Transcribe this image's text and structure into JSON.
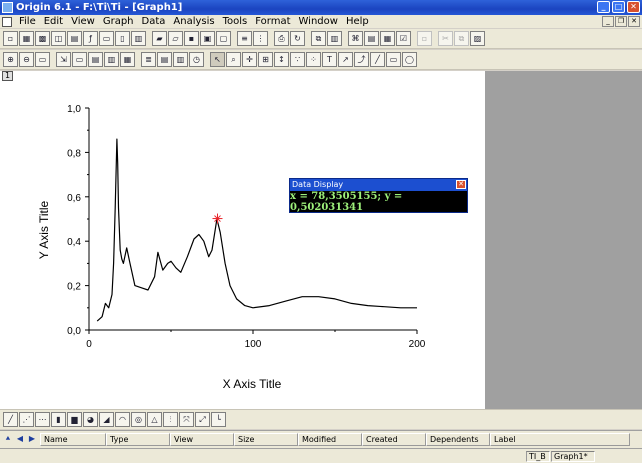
{
  "window": {
    "title": "Origin 6.1 - F:\\Ti\\Ti - [Graph1]"
  },
  "menu": [
    "File",
    "Edit",
    "View",
    "Graph",
    "Data",
    "Analysis",
    "Tools",
    "Format",
    "Window",
    "Help"
  ],
  "layer": {
    "number": "1"
  },
  "data_display": {
    "title": "Data Display",
    "readout": "x = 78,3505155; y = 0,502031341"
  },
  "explorer": {
    "columns": [
      "Name",
      "Type",
      "View",
      "Size",
      "Modified",
      "Created",
      "Dependents",
      "Label"
    ]
  },
  "status": {
    "left": "TI_B",
    "right": "Graph1*"
  },
  "chart_data": {
    "type": "line",
    "xlabel": "X Axis Title",
    "ylabel": "Y Axis Title",
    "xlim": [
      0,
      200
    ],
    "ylim": [
      0,
      1.0
    ],
    "x_ticks": [
      "0",
      "100",
      "200"
    ],
    "y_ticks": [
      "0,0",
      "0,2",
      "0,4",
      "0,6",
      "0,8",
      "1,0"
    ],
    "grid": false,
    "series": [
      {
        "color": "#000000",
        "x": [
          5,
          8,
          10,
          12,
          14,
          15,
          16,
          17,
          17.5,
          18,
          19,
          20,
          21,
          23,
          25,
          28,
          32,
          36,
          40,
          42,
          45,
          48,
          50,
          53,
          56,
          60,
          64,
          67,
          70,
          73,
          75,
          78,
          80,
          83,
          86,
          90,
          95,
          100,
          110,
          120,
          130,
          140,
          150,
          160,
          170,
          180,
          190,
          200
        ],
        "y": [
          0.04,
          0.06,
          0.12,
          0.1,
          0.16,
          0.3,
          0.55,
          0.86,
          0.75,
          0.55,
          0.36,
          0.32,
          0.3,
          0.37,
          0.3,
          0.2,
          0.19,
          0.18,
          0.24,
          0.35,
          0.27,
          0.3,
          0.31,
          0.28,
          0.26,
          0.33,
          0.41,
          0.43,
          0.4,
          0.33,
          0.36,
          0.5,
          0.44,
          0.3,
          0.2,
          0.14,
          0.11,
          0.1,
          0.11,
          0.13,
          0.15,
          0.15,
          0.14,
          0.12,
          0.11,
          0.105,
          0.1,
          0.1
        ]
      }
    ],
    "marker": {
      "x": 78.3505155,
      "y": 0.502031341,
      "color": "#e8252c"
    }
  },
  "colors": {
    "titlebar": "#1b44c0",
    "workspace_bg": "#a0a0a0",
    "readout_text": "#9df07a"
  }
}
